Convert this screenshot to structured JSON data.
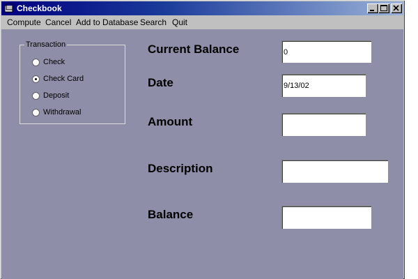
{
  "window": {
    "title": "Checkbook"
  },
  "menu": {
    "items": [
      "Compute",
      "Cancel",
      "Add to Database",
      "Search",
      "Quit"
    ]
  },
  "transaction": {
    "group_label": "Transaction",
    "options": [
      {
        "label": "Check",
        "selected": false
      },
      {
        "label": "Check Card",
        "selected": true
      },
      {
        "label": "Deposit",
        "selected": false
      },
      {
        "label": "Withdrawal",
        "selected": false
      }
    ]
  },
  "fields": {
    "current_balance": {
      "label": "Current Balance",
      "value": "0"
    },
    "date": {
      "label": "Date",
      "value": "9/13/02"
    },
    "amount": {
      "label": "Amount",
      "value": ""
    },
    "description": {
      "label": "Description",
      "value": ""
    },
    "balance": {
      "label": "Balance",
      "value": ""
    }
  },
  "colors": {
    "title_bar_start": "#000080",
    "client_background": "#8e8ea8",
    "chrome": "#c0c0c0"
  }
}
